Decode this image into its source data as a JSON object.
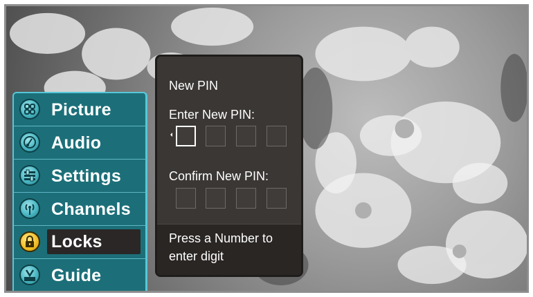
{
  "menu": {
    "items": [
      {
        "label": "Picture",
        "icon": "picture-icon"
      },
      {
        "label": "Audio",
        "icon": "audio-icon"
      },
      {
        "label": "Settings",
        "icon": "settings-icon"
      },
      {
        "label": "Channels",
        "icon": "channels-icon"
      },
      {
        "label": "Locks",
        "icon": "lock-icon",
        "selected": true
      },
      {
        "label": "Guide",
        "icon": "guide-icon"
      }
    ]
  },
  "dialog": {
    "title": "New PIN",
    "enter_label": "Enter New PIN:",
    "confirm_label": "Confirm New PIN:",
    "enter_digits": [
      "",
      "",
      "",
      ""
    ],
    "confirm_digits": [
      "",
      "",
      "",
      ""
    ],
    "hint_line1": "Press a Number to",
    "hint_line2": "enter digit"
  },
  "colors": {
    "menu_bg": "#1c6f79",
    "menu_border": "#58c7d8",
    "dialog_bg": "#3a3735",
    "footer_bg": "#2a2624",
    "selected_icon": "#f2c12a"
  }
}
